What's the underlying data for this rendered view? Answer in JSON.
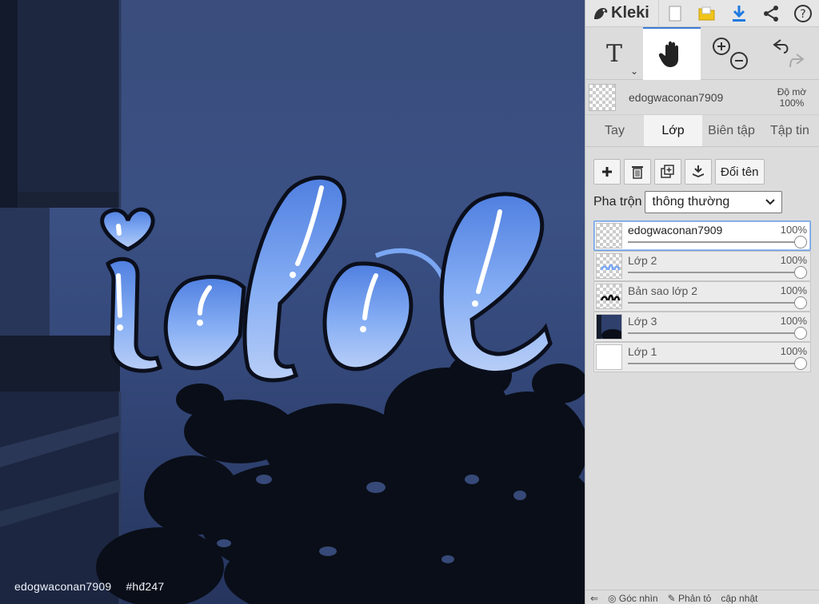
{
  "canvas": {
    "artwork_text": "idol",
    "caption_user": "edogwaconan7909",
    "caption_tag": "#hđ247",
    "colors": {
      "sky": "#3b5083",
      "letters": "#7aa6f2",
      "outline": "#0b0f1c"
    }
  },
  "app": {
    "name": "Kleki"
  },
  "topbar": {
    "icons": [
      "new-file-icon",
      "open-folder-icon",
      "download-icon",
      "share-icon",
      "help-icon"
    ]
  },
  "tools": {
    "text_tool": "T",
    "active": "hand-tool"
  },
  "layer_info": {
    "name": "edogwaconan7909",
    "opacity_label": "Độ mờ",
    "opacity_value": "100%"
  },
  "tabs": [
    {
      "label": "Tay"
    },
    {
      "label": "Lớp"
    },
    {
      "label": "Biên tập"
    },
    {
      "label": "Tập tin"
    }
  ],
  "layer_tools": {
    "rename_label": "Đổi tên"
  },
  "blend": {
    "label": "Pha trộn",
    "value": "thông thường"
  },
  "layers": [
    {
      "name": "edogwaconan7909",
      "opacity": "100%",
      "opacity_value": 1.0
    },
    {
      "name": "Lớp 2",
      "opacity": "100%",
      "opacity_value": 1.0
    },
    {
      "name": "Bản sao lớp 2",
      "opacity": "100%",
      "opacity_value": 1.0
    },
    {
      "name": "Lớp 3",
      "opacity": "100%",
      "opacity_value": 1.0
    },
    {
      "name": "Lớp 1",
      "opacity": "100%",
      "opacity_value": 1.0
    }
  ],
  "bottom": {
    "item_1": "Góc nhìn",
    "item_2": "Phản tỏ",
    "item_3": "cập nhật"
  },
  "accent": "#3d7bd4"
}
